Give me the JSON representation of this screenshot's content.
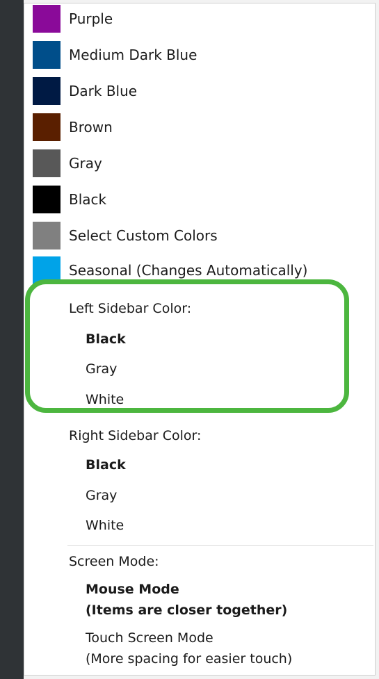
{
  "colors": {
    "sidebar_strip": "#2f3336",
    "highlight": "#4cb63f"
  },
  "color_items": [
    {
      "label": "Purple",
      "swatch": "#8a0a99"
    },
    {
      "label": "Medium Dark Blue",
      "swatch": "#004e8a"
    },
    {
      "label": "Dark Blue",
      "swatch": "#001a44"
    },
    {
      "label": "Brown",
      "swatch": "#5a1f00"
    },
    {
      "label": "Gray",
      "swatch": "#585858"
    },
    {
      "label": "Black",
      "swatch": "#000000"
    },
    {
      "label": "Select Custom Colors",
      "swatch": "#808080"
    },
    {
      "label": "Seasonal (Changes Automatically)",
      "swatch": "#00a3e8"
    }
  ],
  "left_sidebar": {
    "title": "Left Sidebar Color:",
    "options": [
      "Black",
      "Gray",
      "White"
    ],
    "selected": "Black"
  },
  "right_sidebar": {
    "title": "Right Sidebar Color:",
    "options": [
      "Black",
      "Gray",
      "White"
    ],
    "selected": "Black"
  },
  "screen_mode": {
    "title": "Screen Mode:",
    "mouse": {
      "line1": "Mouse Mode",
      "line2": "(Items are closer together)"
    },
    "touch": {
      "line1": "Touch Screen Mode",
      "line2": "(More spacing for easier touch)"
    },
    "selected": "Mouse Mode"
  }
}
